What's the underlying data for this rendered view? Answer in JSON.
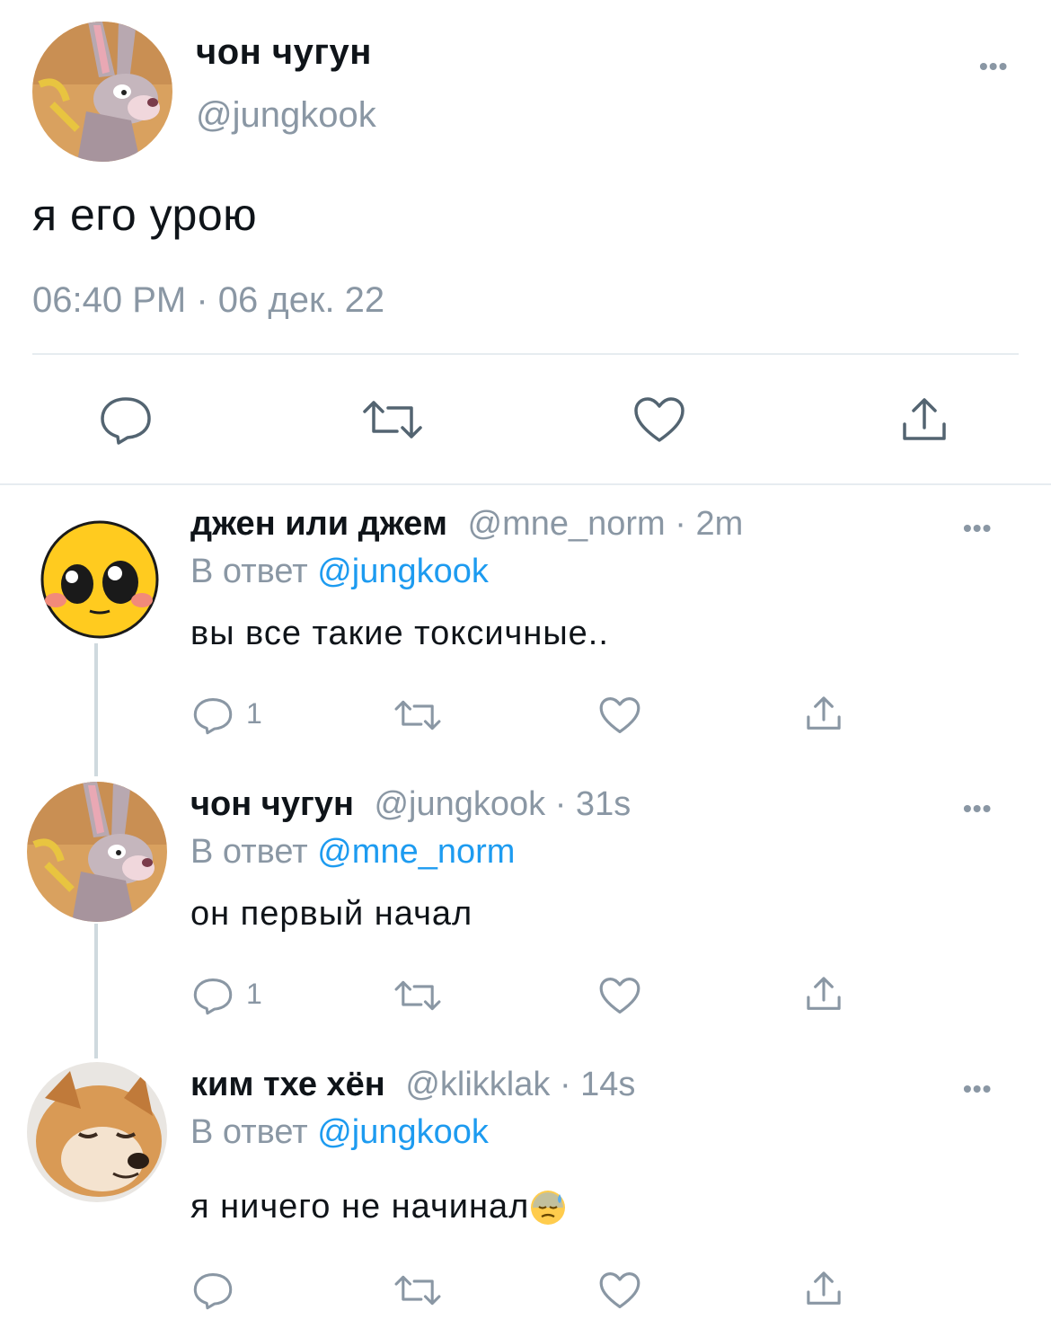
{
  "main_tweet": {
    "name": "чон чугун",
    "handle": "@jungkook",
    "text": "я его урою",
    "timestamp": "06:40 PM · 06 дек. 22",
    "more_label": "•••",
    "actions": [
      "reply-icon",
      "retweet-icon",
      "like-icon",
      "share-icon"
    ]
  },
  "replies": [
    {
      "name": "джен или джем",
      "handle": "@mne_norm",
      "time": "· 2m",
      "reply_prefix": "В ответ",
      "reply_to": "@jungkook",
      "text": "вы все такие токсичные..",
      "reply_count": "1",
      "avatar": "blushing-emoji-avatar"
    },
    {
      "name": "чон чугун",
      "handle": "@jungkook",
      "time": "· 31s",
      "reply_prefix": "В ответ",
      "reply_to": "@mne_norm",
      "text": "он первый начал",
      "reply_count": "1",
      "avatar": "rabbit-avatar"
    },
    {
      "name": "ким тхе хён",
      "handle": "@klikklak",
      "time": "· 14s",
      "reply_prefix": "В ответ",
      "reply_to": "@jungkook",
      "text": "я ничего не начинал",
      "emoji": "downcast-sweat-emoji",
      "avatar": "dog-avatar"
    }
  ],
  "colors": {
    "link": "#1d9bf0",
    "secondary_text": "#8a97a4",
    "divider": "#e6ecf0",
    "thread_line": "#cfd9de"
  }
}
